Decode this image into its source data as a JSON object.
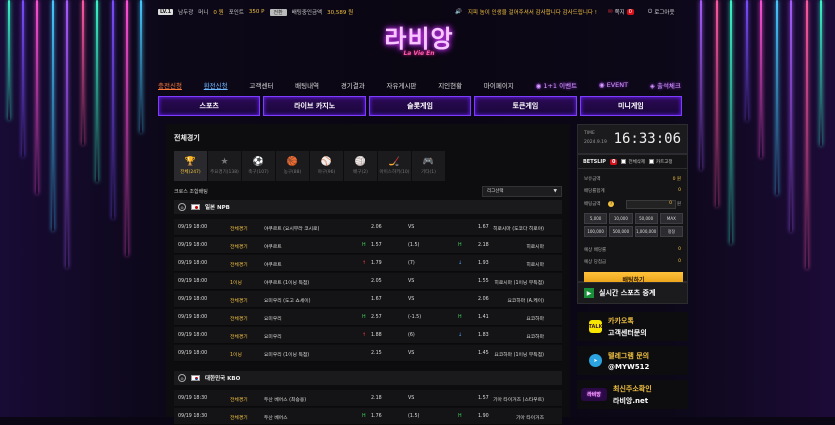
{
  "topbar": {
    "level": "LV.1",
    "username": "남두광",
    "money_label": "머니",
    "money_value": "0 원",
    "point_label": "포인트",
    "point_value": "350 P",
    "exchange_button": "전환",
    "bet_total_label": "배팅중인금액",
    "bet_total_value": "30,589 원",
    "notice": "지피 놈이 인생을 걸어주셔서 감사합니다 감사드립니다 !",
    "message_label": "쪽지",
    "message_count": "0",
    "logout_label": "로그아웃"
  },
  "logo": {
    "main": "라비앙",
    "sub": "La Vie En"
  },
  "nav": {
    "items": [
      "충전신청",
      "환전신청",
      "고객센터",
      "배팅내역",
      "경기결과",
      "자유게시판",
      "지인현황",
      "마이페이지",
      "1+1 이벤트",
      "EVENT",
      "출석체크"
    ]
  },
  "menubar": {
    "items": [
      "스포츠",
      "라이브 카지노",
      "슬롯게임",
      "토큰게임",
      "미니게임"
    ]
  },
  "main": {
    "title": "전체경기",
    "tabs": [
      {
        "icon": "🏆",
        "label": "전체(247)"
      },
      {
        "icon": "★",
        "label": "주요경기(138)"
      },
      {
        "icon": "⚽",
        "label": "축구(107)"
      },
      {
        "icon": "🏀",
        "label": "농구(88)"
      },
      {
        "icon": "⚾",
        "label": "야구(96)"
      },
      {
        "icon": "🏐",
        "label": "배구(2)"
      },
      {
        "icon": "🏒",
        "label": "아이스하키(10)"
      },
      {
        "icon": "🎮",
        "label": "기타(1)"
      }
    ],
    "subtitle": "크로스 조합배팅",
    "league_select": "리그선택",
    "leagues": [
      {
        "name": "일본 NPB",
        "rows": [
          {
            "time": "09/19 18:00",
            "kind": "전체경기",
            "home": "야쿠르트 (요시무라 코시로)",
            "h_arrow": "",
            "ho": "2.06",
            "vs": "VS",
            "a_arrow": "",
            "ao": "1.67",
            "away": "히로시마 (도코다 히로야)"
          },
          {
            "time": "09/19 18:00",
            "kind": "전체경기",
            "home": "야쿠르트",
            "h_arrow": "H",
            "ho": "1.57",
            "vs": "(1.5)",
            "a_arrow": "H",
            "ao": "2.18",
            "away": "히로시마"
          },
          {
            "time": "09/19 18:00",
            "kind": "전체경기",
            "home": "야쿠르트",
            "h_arrow": "↑",
            "ho": "1.79",
            "vs": "(7)",
            "a_arrow": "↓",
            "ao": "1.93",
            "away": "히로시마"
          },
          {
            "time": "09/19 18:00",
            "kind": "1이닝",
            "home": "야쿠르트 (1이닝 득점)",
            "h_arrow": "",
            "ho": "2.05",
            "vs": "VS",
            "a_arrow": "",
            "ao": "1.55",
            "away": "히로시마 (1이닝 무득점)"
          },
          {
            "time": "09/19 18:00",
            "kind": "전체경기",
            "home": "요미우리 (도고 쇼세이)",
            "h_arrow": "",
            "ho": "1.67",
            "vs": "VS",
            "a_arrow": "",
            "ao": "2.06",
            "away": "요코하마 (A.케이)"
          },
          {
            "time": "09/19 18:00",
            "kind": "전체경기",
            "home": "요미우리",
            "h_arrow": "H",
            "ho": "2.57",
            "vs": "(-1.5)",
            "a_arrow": "H",
            "ao": "1.41",
            "away": "요코하마"
          },
          {
            "time": "09/19 18:00",
            "kind": "전체경기",
            "home": "요미우리",
            "h_arrow": "↑",
            "ho": "1.88",
            "vs": "(6)",
            "a_arrow": "↓",
            "ao": "1.83",
            "away": "요코하마"
          },
          {
            "time": "09/19 18:00",
            "kind": "1이닝",
            "home": "요미우리 (1이닝 득점)",
            "h_arrow": "",
            "ho": "2.15",
            "vs": "VS",
            "a_arrow": "",
            "ao": "1.45",
            "away": "요코하마 (1이닝 무득점)"
          }
        ]
      },
      {
        "name": "대한민국 KBO",
        "rows": [
          {
            "time": "09/19 18:30",
            "kind": "전체경기",
            "home": "두산 베어스 (최승용)",
            "h_arrow": "",
            "ho": "2.18",
            "vs": "VS",
            "a_arrow": "",
            "ao": "1.57",
            "away": "기아 타이거즈 (스타우트)"
          },
          {
            "time": "09/19 18:30",
            "kind": "전체경기",
            "home": "두산 베어스",
            "h_arrow": "H",
            "ho": "1.76",
            "vs": "(1.5)",
            "a_arrow": "H",
            "ao": "1.90",
            "away": "기아 타이거즈"
          }
        ]
      }
    ]
  },
  "side": {
    "time_label": "TIME",
    "date": "2024.9.19",
    "clock": "16:33:06",
    "betslip_label": "BETSLIP",
    "betslip_count": "0",
    "delete_all": "전체삭제",
    "fix_cart": "카트고정",
    "money_label": "보유금액",
    "money_value": "0 원",
    "odds_label": "배당률합계",
    "odds_value": "0",
    "bet_amount_label": "배팅금액",
    "bet_amount_value": "0",
    "bet_amount_unit": "원",
    "amount_buttons": [
      "5,000",
      "10,000",
      "50,000",
      "MAX",
      "100,000",
      "500,000",
      "1,000,000",
      "정정"
    ],
    "expected_odds_label": "예상 배당률",
    "expected_odds_value": "0",
    "expected_win_label": "예상 당첨금",
    "expected_win_value": "0",
    "bet_button": "배팅하기",
    "live_label": "실시간 스포츠 중계",
    "kakao_title": "카카오톡",
    "kakao_sub": "고객센터문의",
    "telegram_title": "텔레그램 문의",
    "telegram_id": "@MYW512",
    "domain_title": "최신주소확인",
    "domain_value": "라비앙.net",
    "domain_icon_text": "라비앙"
  }
}
